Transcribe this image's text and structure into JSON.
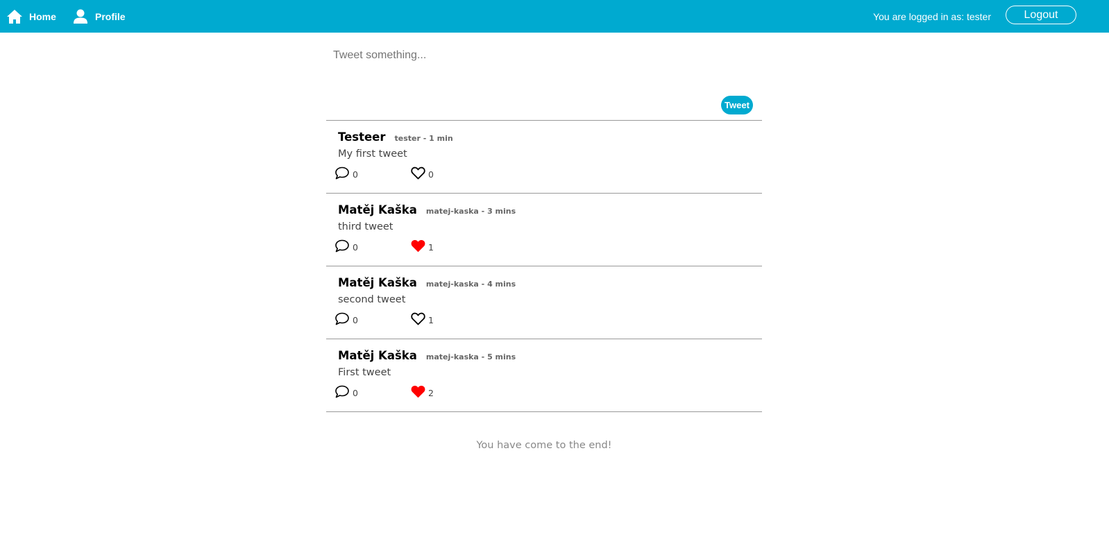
{
  "colors": {
    "accent": "#00aad0",
    "like_active": "#ff0000",
    "text_muted": "#888888"
  },
  "nav": {
    "home_label": "Home",
    "home_icon": "home-icon",
    "profile_label": "Profile",
    "profile_icon": "user-icon",
    "logged_in_text": "You are logged in as: tester",
    "logout_label": "Logout"
  },
  "composer": {
    "placeholder": "Tweet something...",
    "value": "",
    "button_label": "Tweet"
  },
  "tweets": [
    {
      "name": "Testeer",
      "meta": "tester - 1 min",
      "text": "My first tweet",
      "comments": "0",
      "likes": "0",
      "liked": false
    },
    {
      "name": "Matěj Kaška",
      "meta": "matej-kaska - 3 mins",
      "text": "third tweet",
      "comments": "0",
      "likes": "1",
      "liked": true
    },
    {
      "name": "Matěj Kaška",
      "meta": "matej-kaska - 4 mins",
      "text": "second tweet",
      "comments": "0",
      "likes": "1",
      "liked": false
    },
    {
      "name": "Matěj Kaška",
      "meta": "matej-kaska - 5 mins",
      "text": "First tweet",
      "comments": "0",
      "likes": "2",
      "liked": true
    }
  ],
  "end_message": "You have come to the end!"
}
